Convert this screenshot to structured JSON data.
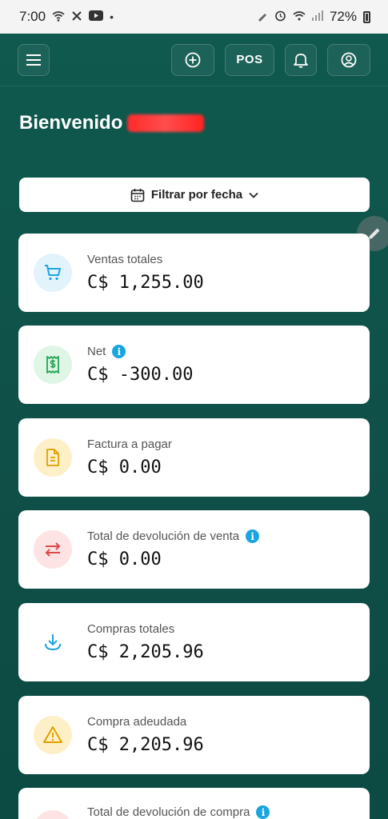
{
  "status_bar": {
    "time": "7:00",
    "battery": "72%"
  },
  "header": {
    "pos_label": "POS"
  },
  "welcome": {
    "text": "Bienvenido"
  },
  "filter": {
    "label": "Filtrar por fecha"
  },
  "cards": [
    {
      "label": "Ventas totales",
      "value": "C$ 1,255.00",
      "icon": "cart-icon",
      "color": "#1aa5e0",
      "bg": "#e3f3fb",
      "info": false
    },
    {
      "label": "Net",
      "value": "C$ -300.00",
      "icon": "receipt-dollar-icon",
      "color": "#22a455",
      "bg": "#dff5e6",
      "info": true
    },
    {
      "label": "Factura a pagar",
      "value": "C$ 0.00",
      "icon": "invoice-icon",
      "color": "#e0a100",
      "bg": "#fdf0c9",
      "info": false
    },
    {
      "label": "Total de devolución de venta",
      "value": "C$ 0.00",
      "icon": "swap-arrows-icon",
      "color": "#e04848",
      "bg": "#fde3e3",
      "info": true
    },
    {
      "label": "Compras totales",
      "value": "C$ 2,205.96",
      "icon": "download-icon",
      "color": "#1aa5e0",
      "bg": "#ffffff",
      "info": false
    },
    {
      "label": "Compra adeudada",
      "value": "C$ 2,205.96",
      "icon": "warning-icon",
      "color": "#e0a100",
      "bg": "#fdf0c9",
      "info": false
    },
    {
      "label": "Total de devolución de compra",
      "value": "",
      "icon": "return-icon",
      "color": "#e04848",
      "bg": "#fde3e3",
      "info": true
    }
  ]
}
